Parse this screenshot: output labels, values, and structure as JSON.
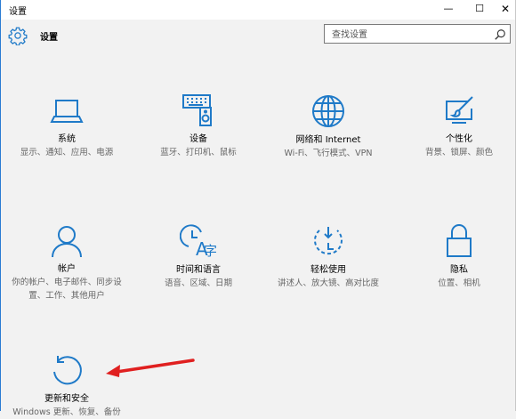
{
  "window": {
    "title": "设置",
    "minimize": "—",
    "maximize": "☐",
    "close": "✕"
  },
  "header": {
    "icon": "gear-icon",
    "title": "设置",
    "search_placeholder": "查找设置",
    "search_icon": "search-icon"
  },
  "tiles": [
    {
      "icon": "laptop-icon",
      "title": "系统",
      "desc": "显示、通知、应用、电源"
    },
    {
      "icon": "keyboard-speaker-icon",
      "title": "设备",
      "desc": "蓝牙、打印机、鼠标"
    },
    {
      "icon": "globe-icon",
      "title": "网络和 Internet",
      "desc": "Wi-Fi、飞行模式、VPN"
    },
    {
      "icon": "paint-screen-icon",
      "title": "个性化",
      "desc": "背景、锁屏、颜色"
    },
    {
      "icon": "person-icon",
      "title": "帐户",
      "desc": "你的帐户、电子邮件、同步设置、工作、其他用户"
    },
    {
      "icon": "time-language-icon",
      "title": "时间和语言",
      "desc": "语音、区域、日期"
    },
    {
      "icon": "ease-of-access-icon",
      "title": "轻松使用",
      "desc": "讲述人、放大镜、高对比度"
    },
    {
      "icon": "lock-icon",
      "title": "隐私",
      "desc": "位置、相机"
    },
    {
      "icon": "refresh-icon",
      "title": "更新和安全",
      "desc": "Windows 更新、恢复、备份"
    }
  ],
  "colors": {
    "accent": "#1f7ac8",
    "annotation": "#e02020"
  }
}
